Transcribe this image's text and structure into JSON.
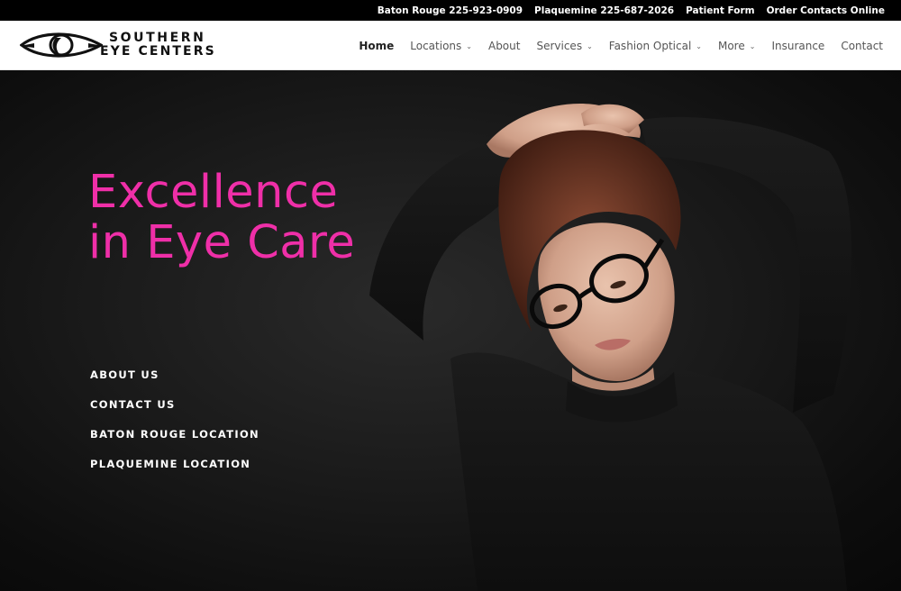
{
  "topbar": {
    "links": [
      "Baton Rouge 225-923-0909",
      "Plaquemine 225-687-2026",
      "Patient Form",
      "Order Contacts Online"
    ]
  },
  "logo": {
    "line1": "SOUTHERN",
    "line2": "EYE CENTERS"
  },
  "nav": {
    "items": [
      {
        "label": "Home",
        "active": true
      },
      {
        "label": "Locations",
        "dropdown": true
      },
      {
        "label": "About"
      },
      {
        "label": "Services",
        "dropdown": true
      },
      {
        "label": "Fashion Optical",
        "dropdown": true
      },
      {
        "label": "More",
        "dropdown": true
      },
      {
        "label": "Insurance"
      },
      {
        "label": "Contact"
      }
    ]
  },
  "hero": {
    "headline_line1": "Excellence",
    "headline_line2": "in Eye Care",
    "headline_color": "#ef2fa8",
    "links": [
      "ABOUT US",
      "CONTACT US",
      "BATON ROUGE LOCATION",
      "PLAQUEMINE LOCATION"
    ]
  },
  "icons": {
    "logo": "eye-logo-icon",
    "dropdown": "chevron-down-icon"
  }
}
